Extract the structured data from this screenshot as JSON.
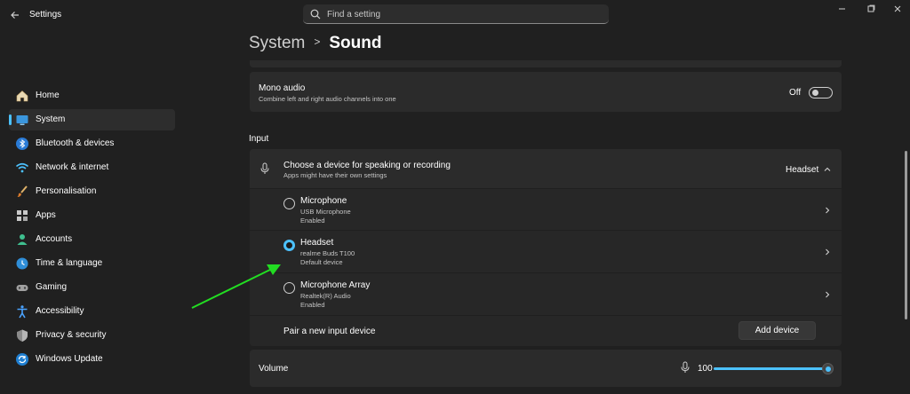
{
  "app": {
    "title": "Settings",
    "search_placeholder": "Find a setting"
  },
  "colors": {
    "accent": "#4cc2ff",
    "background": "#202020",
    "card": "#2b2b2b",
    "annotation_arrow": "#22dd22"
  },
  "sidebar": {
    "items": [
      {
        "label": "Home",
        "icon": "home-icon",
        "active": false
      },
      {
        "label": "System",
        "icon": "monitor-icon",
        "active": true
      },
      {
        "label": "Bluetooth & devices",
        "icon": "bluetooth-icon",
        "active": false
      },
      {
        "label": "Network & internet",
        "icon": "wifi-icon",
        "active": false
      },
      {
        "label": "Personalisation",
        "icon": "paintbrush-icon",
        "active": false
      },
      {
        "label": "Apps",
        "icon": "apps-grid-icon",
        "active": false
      },
      {
        "label": "Accounts",
        "icon": "person-icon",
        "active": false
      },
      {
        "label": "Time & language",
        "icon": "globe-clock-icon",
        "active": false
      },
      {
        "label": "Gaming",
        "icon": "gamepad-icon",
        "active": false
      },
      {
        "label": "Accessibility",
        "icon": "accessibility-icon",
        "active": false
      },
      {
        "label": "Privacy & security",
        "icon": "shield-icon",
        "active": false
      },
      {
        "label": "Windows Update",
        "icon": "update-icon",
        "active": false
      }
    ]
  },
  "breadcrumb": {
    "parent": "System",
    "separator": ">",
    "current": "Sound"
  },
  "mono_audio": {
    "title": "Mono audio",
    "subtitle": "Combine left and right audio channels into one",
    "state_label": "Off",
    "enabled": false
  },
  "input": {
    "section_title": "Input",
    "chooser": {
      "title": "Choose a device for speaking or recording",
      "subtitle": "Apps might have their own settings",
      "selected_value": "Headset",
      "expanded": true
    },
    "devices": [
      {
        "name": "Microphone",
        "detail": "USB Microphone",
        "status": "Enabled",
        "selected": false
      },
      {
        "name": "Headset",
        "detail": "realme Buds T100",
        "status": "Default device",
        "selected": true
      },
      {
        "name": "Microphone Array",
        "detail": "Realtek(R) Audio",
        "status": "Enabled",
        "selected": false
      }
    ],
    "pair": {
      "label": "Pair a new input device",
      "button_label": "Add device"
    }
  },
  "volume": {
    "label": "Volume",
    "value_text": "100",
    "value": 100,
    "max": 100
  }
}
